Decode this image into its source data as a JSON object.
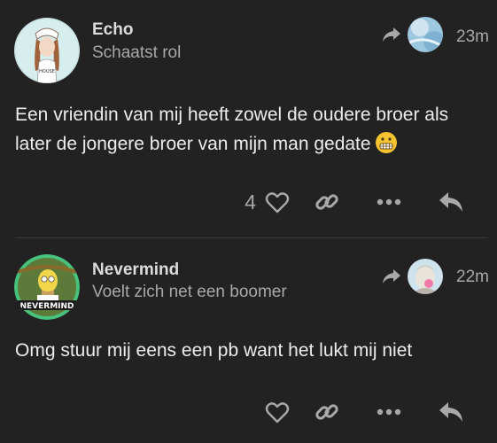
{
  "posts": [
    {
      "username": "Echo",
      "user_title": "Schaatst rol",
      "time": "23m",
      "body": "Een vriendin van mij heeft zowel de oudere broer als later de jongere broer van mijn man gedate",
      "emoji": "grimacing-face",
      "like_count": "4"
    },
    {
      "username": "Nevermind",
      "user_title": "Voelt zich net een boomer",
      "time": "22m",
      "body": "Omg stuur mij eens een pb want het lukt mij niet",
      "avatar_text": "NEVERMIND",
      "like_count": ""
    }
  ],
  "icons": {
    "reply_to": "reply-arrow-icon",
    "like": "heart-icon",
    "share": "link-icon",
    "more": "ellipsis-icon",
    "reply": "reply-icon"
  },
  "colors": {
    "background": "#222222",
    "text": "#ececec",
    "muted": "#a8a8a8"
  }
}
